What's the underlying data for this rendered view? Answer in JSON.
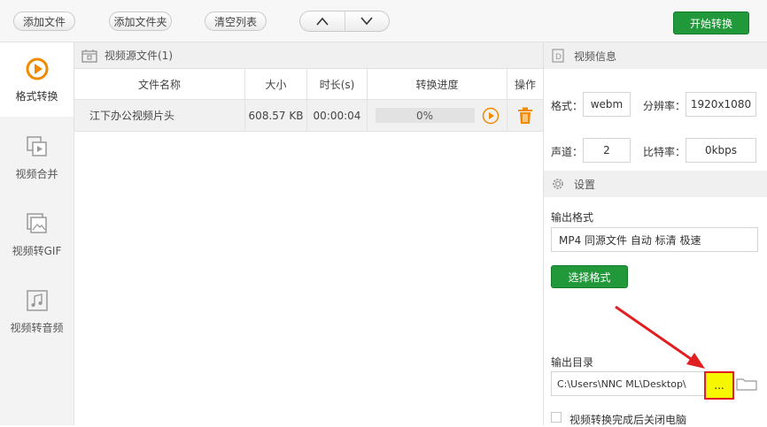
{
  "toolbar": {
    "add_file": "添加文件",
    "add_folder": "添加文件夹",
    "clear_list": "清空列表",
    "start_convert": "开始转换"
  },
  "sidebar": {
    "items": [
      {
        "label": "格式转换",
        "icon": "format-convert-icon",
        "active": true
      },
      {
        "label": "视频合并",
        "icon": "video-merge-icon",
        "active": false
      },
      {
        "label": "视频转GIF",
        "icon": "gif-icon",
        "active": false
      },
      {
        "label": "视频转音频",
        "icon": "audio-icon",
        "active": false
      }
    ]
  },
  "file_list": {
    "title": "视频源文件(1)",
    "columns": [
      "文件名称",
      "大小",
      "时长(s)",
      "转换进度",
      "操作"
    ],
    "rows": [
      {
        "name": "江下办公视频片头",
        "size": "608.57 KB",
        "duration": "00:00:04",
        "progress": "0%"
      }
    ]
  },
  "video_info": {
    "title": "视频信息",
    "format_label": "格式：",
    "format_value": "webm",
    "resolution_label": "分辨率：",
    "resolution_value": "1920x1080",
    "channels_label": "声道：",
    "channels_value": "2",
    "bitrate_label": "比特率：",
    "bitrate_value": "0kbps"
  },
  "settings": {
    "title": "设置",
    "output_format_label": "输出格式",
    "output_format_value": "MP4 同源文件 自动 标清 极速",
    "select_format_button": "选择格式",
    "output_dir_label": "输出目录",
    "output_dir_value": "C:\\Users\\NNC ML\\Desktop\\",
    "browse_button": "...",
    "shutdown_label": "视频转换完成后关闭电脑"
  },
  "colors": {
    "accent_green": "#21983a",
    "accent_orange": "#f08a00",
    "annotation_red": "#e02020",
    "highlight_yellow": "#f7f700"
  }
}
